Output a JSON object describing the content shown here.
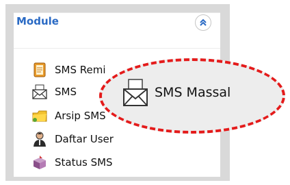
{
  "module": {
    "title": "Module",
    "collapse_icon": "double-chevron-up-icon"
  },
  "menu": [
    {
      "label": "SMS Remi",
      "icon": "calendar-icon"
    },
    {
      "label": "SMS",
      "icon": "envelope-icon"
    },
    {
      "label": "Arsip SMS",
      "icon": "folder-icon"
    },
    {
      "label": "Daftar User",
      "icon": "user-icon"
    },
    {
      "label": "Status SMS",
      "icon": "status-box-icon"
    }
  ],
  "callout": {
    "label": "SMS Massal",
    "icon": "envelope-icon",
    "border_color": "#e41b1b"
  },
  "colors": {
    "title": "#2a6ac4",
    "panel_bg": "#d9d9d9"
  }
}
